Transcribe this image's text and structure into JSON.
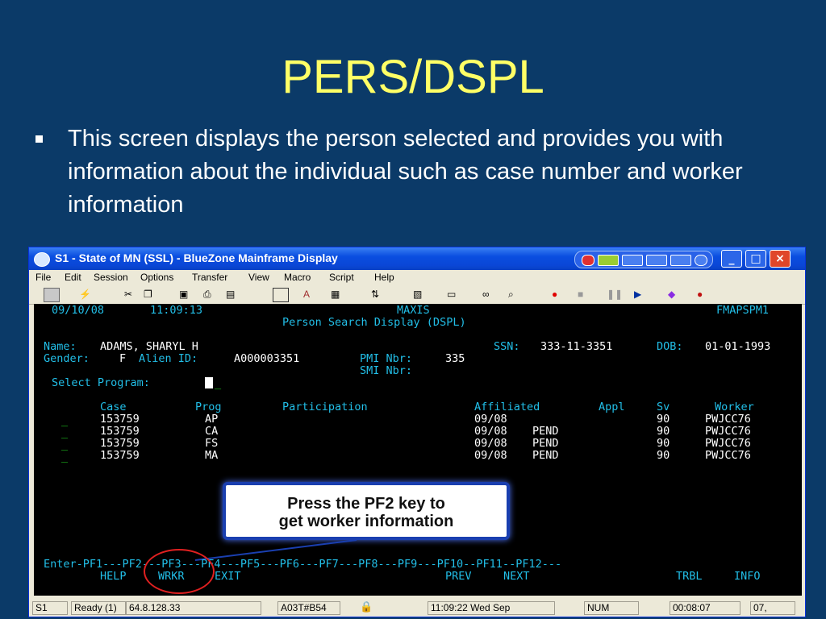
{
  "slide": {
    "title": "PERS/DSPL",
    "bullet": "This screen displays the person selected and provides you with information about the individual such as case number and worker information"
  },
  "window": {
    "title": "S1 - State of MN (SSL) - BlueZone Mainframe Display",
    "menu": [
      "File",
      "Edit",
      "Session",
      "Options",
      "Transfer",
      "View",
      "Macro",
      "Script",
      "Help"
    ]
  },
  "terminal": {
    "date": "09/10/08",
    "time": "11:09:13",
    "system": "MAXIS",
    "screen_id": "FMAPSPM1",
    "screen_title": "Person Search Display (DSPL)",
    "name_label": "Name:",
    "name_value": "ADAMS, SHARYL H",
    "ssn_label": "SSN:",
    "ssn_value": "333-11-3351",
    "dob_label": "DOB:",
    "dob_value": "01-01-1993",
    "gender_label": "Gender:",
    "gender_value": "F",
    "alien_label": "Alien ID:",
    "alien_value": "A000003351",
    "pmi_label": "PMI Nbr:",
    "pmi_value": "335",
    "smi_label": "SMI Nbr:",
    "select_label": "Select Program:",
    "columns": [
      "Case",
      "Prog",
      "Participation",
      "Affiliated",
      "Appl",
      "Sv",
      "Worker"
    ],
    "rows": [
      {
        "case": "153759",
        "prog": "AP",
        "affiliated": "09/08",
        "status": "",
        "sv": "90",
        "worker": "PWJCC76"
      },
      {
        "case": "153759",
        "prog": "CA",
        "affiliated": "09/08",
        "status": "PEND",
        "sv": "90",
        "worker": "PWJCC76"
      },
      {
        "case": "153759",
        "prog": "FS",
        "affiliated": "09/08",
        "status": "PEND",
        "sv": "90",
        "worker": "PWJCC76"
      },
      {
        "case": "153759",
        "prog": "MA",
        "affiliated": "09/08",
        "status": "PEND",
        "sv": "90",
        "worker": "PWJCC76"
      }
    ],
    "pf_line": "Enter-PF1---PF2---PF3---PF4---PF5---PF6---PF7---PF8---PF9---PF10--PF11--PF12---",
    "pf_labels": {
      "help": "HELP",
      "wrkr": "WRKR",
      "exit": "EXIT",
      "prev": "PREV",
      "next": "NEXT",
      "trbl": "TRBL",
      "info": "INFO"
    }
  },
  "callout": {
    "line1": "Press the PF2 key to",
    "line2": "get worker information"
  },
  "status_bar": {
    "session": "S1",
    "ready": "Ready (1)",
    "ip": "64.8.128.33",
    "device": "A03T#B54",
    "clock": "11:09:22 Wed Sep",
    "num": "NUM",
    "elapsed": "00:08:07",
    "cursor": "07,"
  }
}
